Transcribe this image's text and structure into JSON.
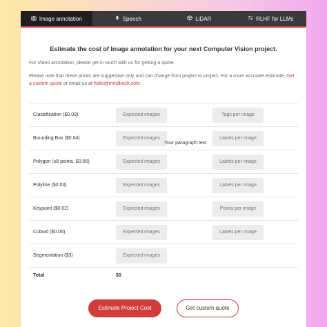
{
  "tabs": [
    {
      "label": "Image annotation",
      "icon": "camera-icon",
      "active": true
    },
    {
      "label": "Speech",
      "icon": "microphone-icon",
      "active": false
    },
    {
      "label": "LiDAR",
      "icon": "lidar-icon",
      "active": false
    },
    {
      "label": "RLHF for LLMs",
      "icon": "sliders-icon",
      "active": false
    }
  ],
  "heading": "Estimate the cost of Image annotation for your next Computer Vision project.",
  "para1": "For Video annotation, please get in touch with us for getting a quote.",
  "para2_pre": "Please note that these prices are suggestive only and can change from project to project. For a more accurate estimate,",
  "para2_link1": "Get a custom quote",
  "para2_mid": "or email us at",
  "para2_link2": "hello@mindkosh.com",
  "floating_text": "Your paragraph text",
  "rows": [
    {
      "label": "Classification ($0.03)",
      "p1": "Expected images",
      "p2": "Tags per image"
    },
    {
      "label": "Bounding Box ($0.04)",
      "p1": "Expected images",
      "p2": "Labels per image"
    },
    {
      "label": "Polygon (≤8 points, $0.06)",
      "p1": "Expected images",
      "p2": "Labels per image"
    },
    {
      "label": "Polyline ($0.03)",
      "p1": "Expected images",
      "p2": "Labels per image"
    },
    {
      "label": "Keypoint ($0.02)",
      "p1": "Expected images",
      "p2": "Points per image"
    },
    {
      "label": "Cuboid ($0.06)",
      "p1": "Expected images",
      "p2": "Labels per image"
    },
    {
      "label": "Segmentation ($3)",
      "p1": "Expected images",
      "p2": ""
    }
  ],
  "total_label": "Total",
  "total_value": "$0",
  "btn_estimate": "Estimate Project Cost",
  "btn_quote": "Get custom quote",
  "colors": {
    "accent": "#d13b3b",
    "tabbar": "#3a3a3a"
  }
}
